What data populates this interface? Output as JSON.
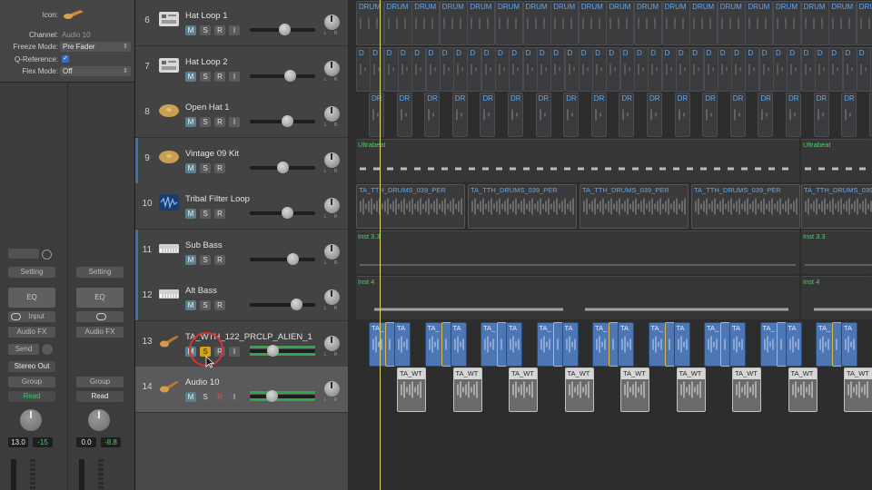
{
  "inspector": {
    "icon_label": "Icon:",
    "channel_label": "Channel:",
    "channel_value": "Audio 10",
    "freeze_label": "Freeze Mode:",
    "freeze_value": "Pre Fader",
    "qref_label": "Q-Reference:",
    "qref_check": "✓",
    "flex_label": "Flex Mode:",
    "flex_value": "Off"
  },
  "strip_a": {
    "setting": "Setting",
    "eq": "EQ",
    "input": "Input",
    "audio_fx": "Audio FX",
    "send": "Send",
    "output": "Stereo Out",
    "group": "Group",
    "automation": "Read",
    "pan_value": "13.0",
    "gain_value": "-15"
  },
  "strip_b": {
    "setting": "Setting",
    "eq": "EQ",
    "audio_fx": "Audio FX",
    "group": "Group",
    "automation": "Read",
    "pan_value": "0.0",
    "gain_value": "-8.8"
  },
  "tracks": [
    {
      "num": "6",
      "name": "Hat Loop 1",
      "icon": "drum-machine-icon",
      "buttons": [
        "M",
        "S",
        "R",
        "I"
      ],
      "fader": 0.55
    },
    {
      "num": "7",
      "name": "Hat Loop 2",
      "icon": "drum-machine-icon",
      "buttons": [
        "M",
        "S",
        "R",
        "I"
      ],
      "fader": 0.65
    },
    {
      "num": "8",
      "name": "Open Hat 1",
      "icon": "cymbal-icon",
      "buttons": [
        "M",
        "S",
        "R",
        "I"
      ],
      "fader": 0.6
    },
    {
      "num": "9",
      "name": "Vintage 09 Kit",
      "icon": "cymbal-icon",
      "buttons": [
        "M",
        "S",
        "R"
      ],
      "fader": 0.5
    },
    {
      "num": "10",
      "name": "Tribal Filter Loop",
      "icon": "waveform-icon",
      "buttons": [
        "M",
        "S",
        "R"
      ],
      "fader": 0.6
    },
    {
      "num": "11",
      "name": "Sub Bass",
      "icon": "keyboard-icon",
      "buttons": [
        "M",
        "S",
        "R"
      ],
      "fader": 0.7
    },
    {
      "num": "12",
      "name": "Alt Bass",
      "icon": "keyboard-icon",
      "buttons": [
        "M",
        "S",
        "R"
      ],
      "fader": 0.76
    },
    {
      "num": "13",
      "name": "TA_WTH_122_PRCLP_ALIEN_1",
      "icon": "guitar-icon",
      "buttons": [
        "M",
        "S",
        "R",
        "I"
      ],
      "fader": 0.32
    },
    {
      "num": "14",
      "name": "Audio 10",
      "icon": "guitar-icon",
      "buttons": [
        "M",
        "S",
        "R",
        "I"
      ],
      "fader": 0.3
    }
  ],
  "regions": {
    "drum": "DRUM",
    "d": "D",
    "dr": "DR",
    "ultrabeat": "Ultrabeat",
    "tribal": "TA_TTH_DRUMS_039_PER",
    "inst33": "Inst 3.3",
    "inst4": "Inst 4",
    "ta": "TA",
    "ta_under": "TA_",
    "ta_wt": "TA_WT"
  },
  "colors": {
    "accent_blue": "#3d6fb3",
    "solo_yellow": "#d6a31c",
    "region_green_text": "#4fd16a",
    "region_blue": "#4d76b5",
    "playhead": "#e0d96a"
  }
}
